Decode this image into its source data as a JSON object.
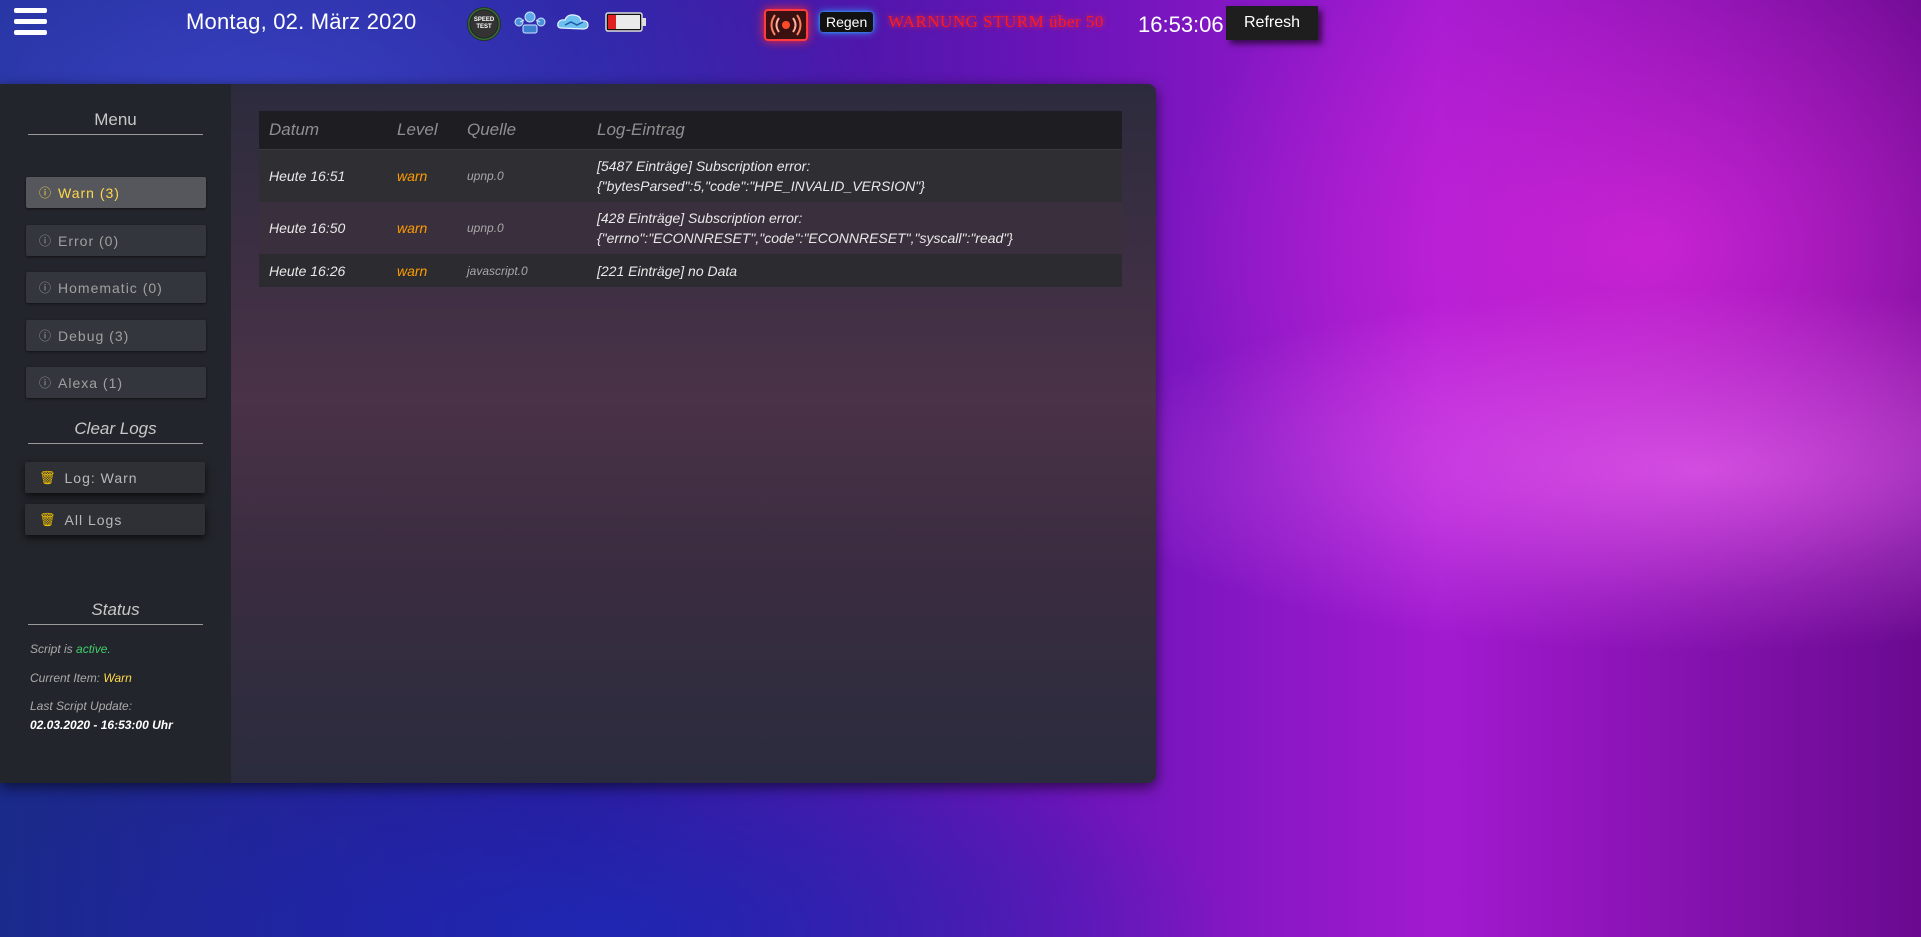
{
  "header": {
    "date": "Montag, 02. März 2020",
    "speedtest_label": "SPEED TEST",
    "rain_label": "Regen",
    "storm_warning": "WARNUNG STURM über 50",
    "clock": "16:53:06",
    "refresh_label": "Refresh"
  },
  "sidebar": {
    "menu_title": "Menu",
    "items": [
      {
        "label": "Warn (3)",
        "active": true
      },
      {
        "label": "Error (0)",
        "active": false
      },
      {
        "label": "Homematic (0)",
        "active": false
      },
      {
        "label": "Debug (3)",
        "active": false
      },
      {
        "label": "Alexa (1)",
        "active": false
      }
    ],
    "clear_title": "Clear Logs",
    "clear_items": [
      {
        "label": "Log: Warn"
      },
      {
        "label": "All Logs"
      }
    ],
    "status_title": "Status",
    "status": {
      "script_prefix": "Script is",
      "script_state": "active.",
      "current_item_prefix": "Current Item:",
      "current_item": "Warn",
      "last_update_label": "Last Script Update:",
      "last_update_value": "02.03.2020 - 16:53:00 Uhr"
    }
  },
  "log": {
    "columns": [
      "Datum",
      "Level",
      "Quelle",
      "Log-Eintrag"
    ],
    "rows": [
      {
        "date": "Heute 16:51",
        "level": "warn",
        "source": "upnp.0",
        "entry_line1": "[5487 Einträge] Subscription error:",
        "entry_line2": "{\"bytesParsed\":5,\"code\":\"HPE_INVALID_VERSION\"}"
      },
      {
        "date": "Heute 16:50",
        "level": "warn",
        "source": "upnp.0",
        "entry_line1": "[428 Einträge] Subscription error:",
        "entry_line2": "{\"errno\":\"ECONNRESET\",\"code\":\"ECONNRESET\",\"syscall\":\"read\"}"
      },
      {
        "date": "Heute 16:26",
        "level": "warn",
        "source": "javascript.0",
        "entry_line1": "[221 Einträge] no Data",
        "entry_line2": ""
      }
    ]
  },
  "colors": {
    "accent_yellow": "#ffd84a",
    "warn_orange": "#ff9c00",
    "alarm_red": "#ff1a1a",
    "rain_glow": "#2ea8ff",
    "status_green": "#3fcf6a"
  },
  "icons": [
    "hamburger-menu-icon",
    "speedtest-icon",
    "network-icon",
    "cloud-icon",
    "battery-icon",
    "alarm-icon",
    "info-icon",
    "trash-icon"
  ]
}
